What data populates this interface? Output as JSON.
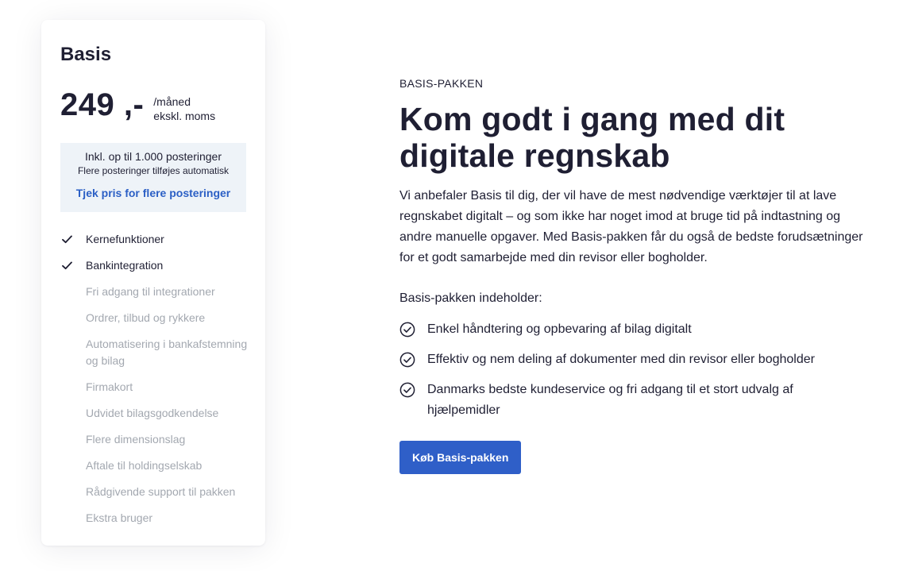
{
  "card": {
    "plan_name": "Basis",
    "price": "249 ,-",
    "price_period": "/måned",
    "price_note": "ekskl. moms",
    "postings": {
      "included": "Inkl. op til 1.000 posteringer",
      "note": "Flere posteringer tilføjes automatisk",
      "link": "Tjek pris for flere posteringer"
    },
    "features": [
      {
        "label": "Kernefunktioner",
        "included": true
      },
      {
        "label": "Bankintegration",
        "included": true
      },
      {
        "label": "Fri adgang til integrationer",
        "included": false
      },
      {
        "label": "Ordrer, tilbud og rykkere",
        "included": false
      },
      {
        "label": "Automatisering i bankafstemning og bilag",
        "included": false
      },
      {
        "label": "Firmakort",
        "included": false
      },
      {
        "label": "Udvidet bilagsgodkendelse",
        "included": false
      },
      {
        "label": "Flere dimensionslag",
        "included": false
      },
      {
        "label": "Aftale til holdingselskab",
        "included": false
      },
      {
        "label": "Rådgivende support til pakken",
        "included": false
      },
      {
        "label": "Ekstra bruger",
        "included": false
      }
    ],
    "feature_icon": "checkmark-icon"
  },
  "main": {
    "eyebrow": "BASIS-PAKKEN",
    "headline": "Kom godt i gang med dit digitale regnskab",
    "description": "Vi anbefaler Basis til dig, der vil have de mest nødvendige værktøjer til at lave regnskabet digitalt – og som ikke har noget imod at bruge tid på indtastning og andre manuelle opgaver. Med Basis-pakken får du også de bedste forudsætninger for et godt samarbejde med din revisor eller bogholder.",
    "contains_label": "Basis-pakken indeholder:",
    "benefits": [
      "Enkel håndtering og opbevaring af bilag digitalt",
      "Effektiv og nem deling af dokumenter med din revisor eller bogholder",
      "Danmarks bedste kundeservice og fri adgang til et stort udvalg af hjælpemidler"
    ],
    "benefit_icon": "circle-check-icon",
    "buy_button": "Køb Basis-pakken"
  },
  "colors": {
    "text": "#1f1f33",
    "muted": "#a3a8b0",
    "link": "#2b5fc5",
    "button": "#2f5fc8",
    "postings_bg": "#eef3f8"
  }
}
